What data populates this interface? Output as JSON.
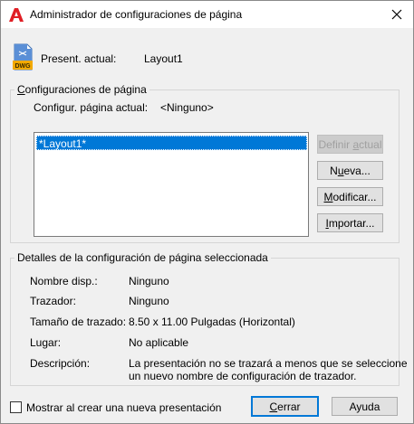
{
  "window": {
    "title": "Administrador de configuraciones de página",
    "close_symbol": "✕",
    "icon": "autocad-logo-icon"
  },
  "current_layout": {
    "icon": "dwg-file-icon",
    "icon_text": "DWG",
    "label": "Present. actual:",
    "value": "Layout1"
  },
  "page_setups": {
    "group_title": "Configuraciones de página",
    "current_label": "Configur. página actual:",
    "current_value": "<Ninguno>",
    "list_items": [
      "*Layout1*"
    ],
    "buttons": {
      "set_current": "Definir actual",
      "new": "Nueva...",
      "modify": "Modificar...",
      "import": "Importar..."
    }
  },
  "details": {
    "group_title": "Detalles de la configuración de página seleccionada",
    "rows": [
      {
        "label": "Nombre disp.:",
        "value": "Ninguno"
      },
      {
        "label": "Trazador:",
        "value": "Ninguno"
      },
      {
        "label": "Tamaño de trazado:",
        "value": "8.50 x 11.00 Pulgadas (Horizontal)"
      },
      {
        "label": "Lugar:",
        "value": "No aplicable"
      },
      {
        "label": "Descripción:",
        "value": "La presentación no se trazará a menos que se seleccione",
        "value2": "un nuevo nombre de configuración de trazador."
      }
    ]
  },
  "footer": {
    "checkbox_label": "Mostrar al crear una nueva presentación",
    "checkbox_checked": false,
    "close_button": "Cerrar",
    "help_button": "Ayuda"
  },
  "colors": {
    "accent": "#0078d7",
    "autocad_red": "#e01e25"
  }
}
